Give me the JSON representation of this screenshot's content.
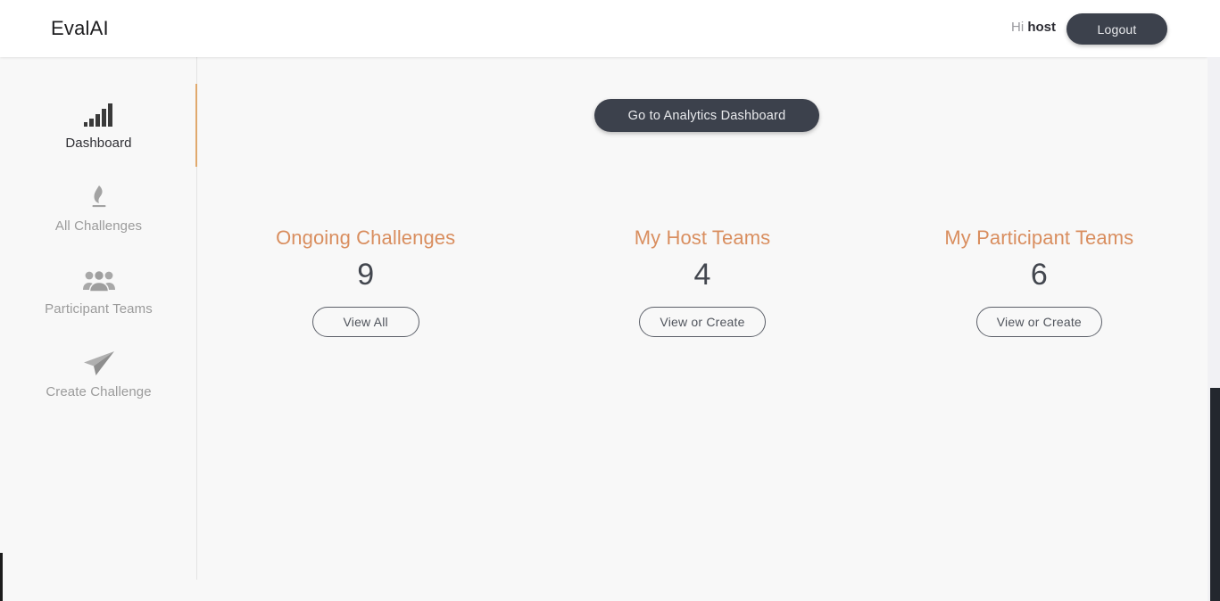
{
  "header": {
    "brand_name": "EvalAI",
    "greeting_prefix": "Hi",
    "username": "host",
    "logout_label": "Logout"
  },
  "sidebar": {
    "items": [
      {
        "label": "Dashboard",
        "icon": "bar-chart-icon",
        "active": true
      },
      {
        "label": "All Challenges",
        "icon": "flame-podium-icon",
        "active": false
      },
      {
        "label": "Participant Teams",
        "icon": "people-group-icon",
        "active": false
      },
      {
        "label": "Create Challenge",
        "icon": "paper-plane-icon",
        "active": false
      }
    ]
  },
  "main": {
    "analytics_button_label": "Go to Analytics Dashboard",
    "cards": [
      {
        "title": "Ongoing Challenges",
        "count": "9",
        "button_label": "View All"
      },
      {
        "title": "My Host Teams",
        "count": "4",
        "button_label": "View or Create"
      },
      {
        "title": "My Participant Teams",
        "count": "6",
        "button_label": "View or Create"
      }
    ]
  },
  "colors": {
    "accent_orange": "#d98e5f",
    "rail_orange": "#e0a96d",
    "dark_button": "#3c414c",
    "page_background": "#f8f8f8",
    "header_background": "#ffffff",
    "muted_text": "#9b9b9b",
    "active_text": "#2e2e33"
  }
}
